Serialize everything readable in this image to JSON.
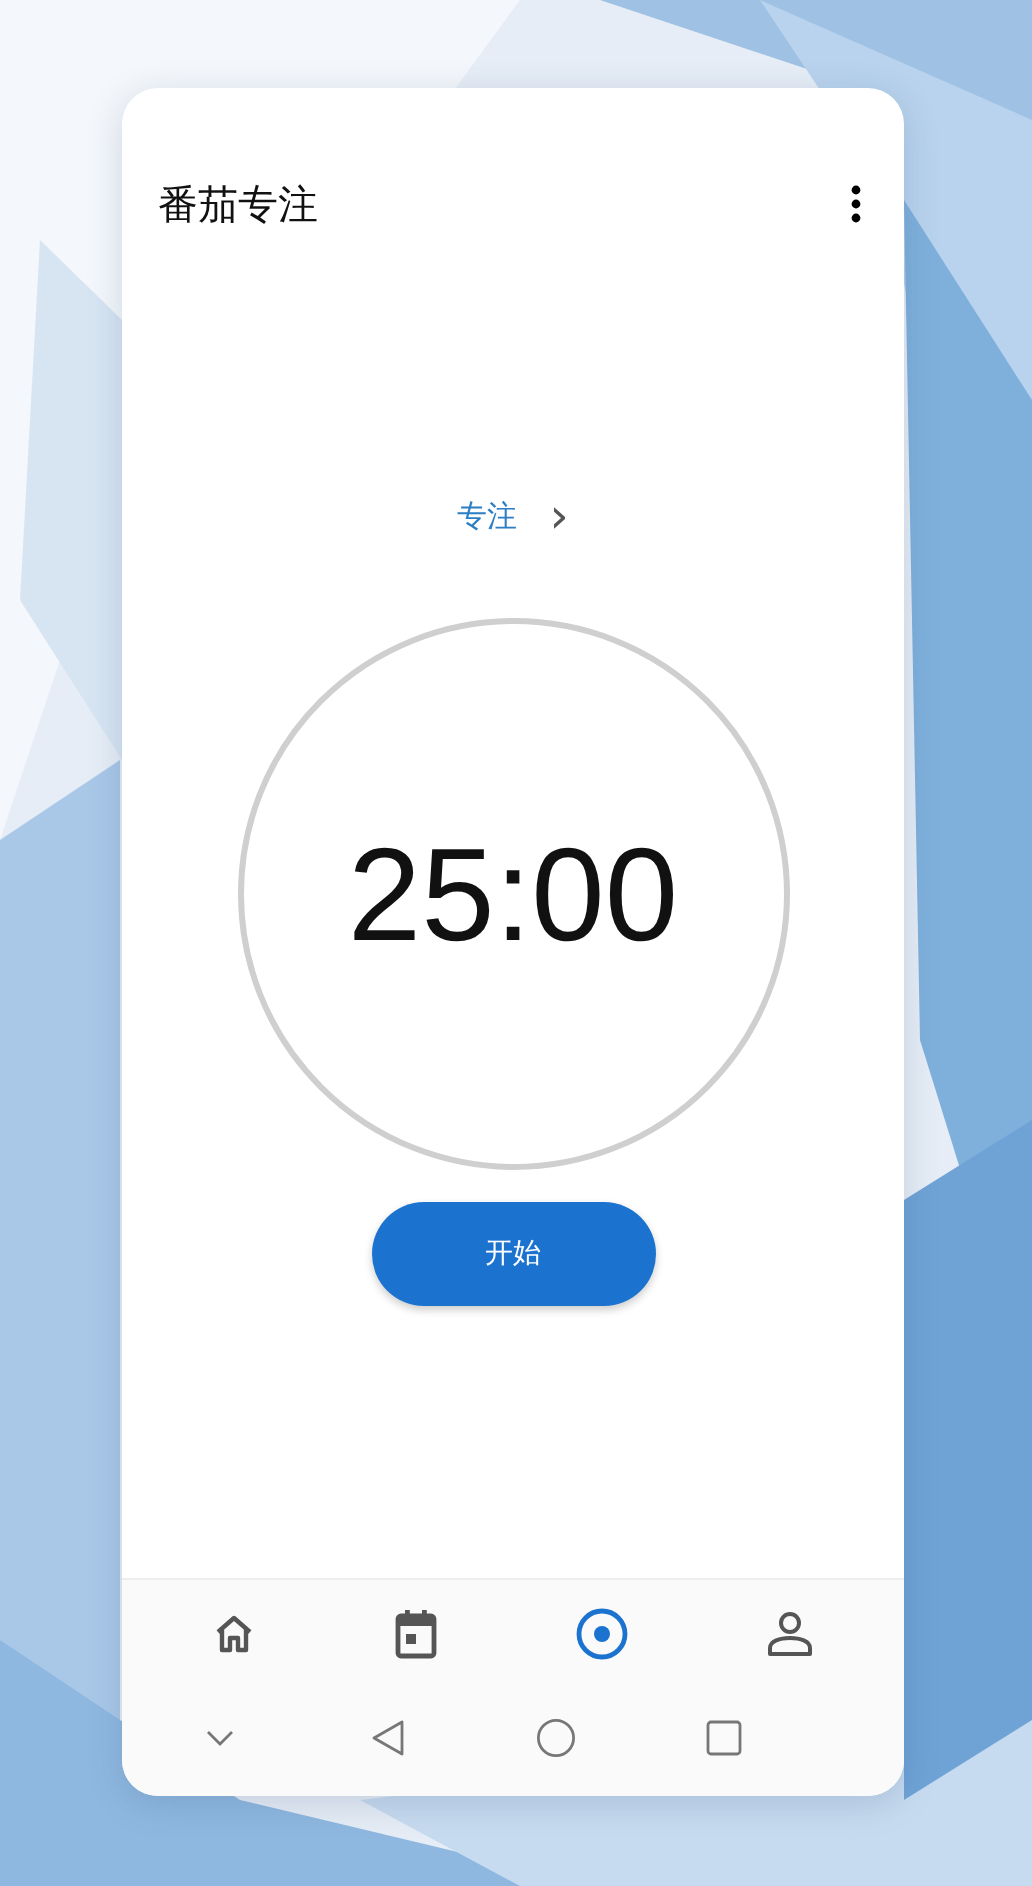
{
  "app_bar": {
    "title": "番茄专注"
  },
  "mode": {
    "label": "专注",
    "chevron": "›"
  },
  "timer": {
    "time": "25:00"
  },
  "start_button": {
    "label": "开始"
  },
  "bottom_nav": [
    {
      "kind": "home",
      "selected": false
    },
    {
      "kind": "calendar",
      "selected": false
    },
    {
      "kind": "focus",
      "selected": true
    },
    {
      "kind": "profile",
      "selected": false
    }
  ],
  "system_nav": [
    {
      "kind": "hide"
    },
    {
      "kind": "back"
    },
    {
      "kind": "home"
    },
    {
      "kind": "recents"
    }
  ]
}
